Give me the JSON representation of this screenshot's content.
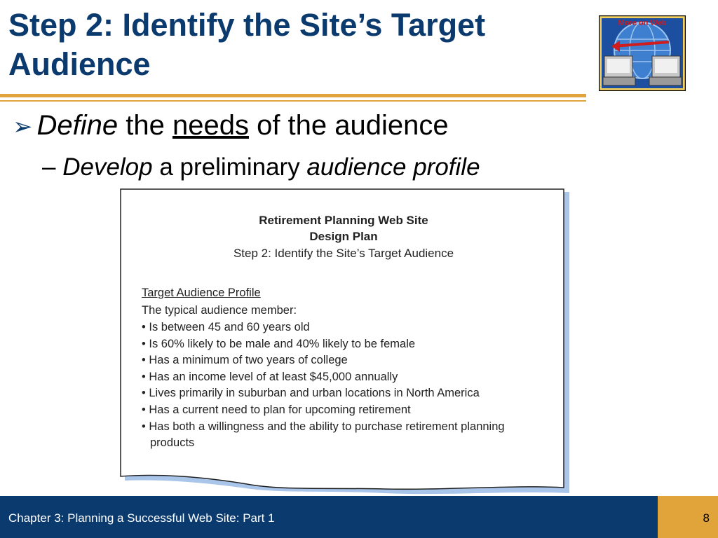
{
  "slide": {
    "title": "Step 2: Identify the Site’s Target Audience",
    "web_badge_label": "More on Web",
    "bullet1": {
      "italic": "Define",
      "pre": " the ",
      "underlined": "needs",
      "post": " of the audience"
    },
    "bullet2": {
      "dash": "–",
      "italic1": "Develop",
      "mid": " a preliminary ",
      "italic2": "audience profile"
    }
  },
  "document": {
    "heading1": "Retirement Planning Web Site",
    "heading2": "Design Plan",
    "heading3": "Step 2: Identify the Site’s Target Audience",
    "profile_label": "Target Audience Profile",
    "intro": "The typical audience member:",
    "items": [
      "• Is between 45 and 60 years old",
      "• Is 60% likely to be male and 40% likely to be female",
      "• Has a minimum of two years of college",
      "• Has an income level of at least $45,000 annually",
      "• Lives primarily in suburban and urban locations in North America",
      "• Has a current need to plan for upcoming retirement",
      "• Has both a willingness and the ability to purchase retirement planning"
    ],
    "last_item_continuation": "products"
  },
  "footer": {
    "chapter": "Chapter 3: Planning a Successful Web Site: Part 1",
    "page_number": "8"
  },
  "colors": {
    "title_blue": "#0b3a6e",
    "accent_gold": "#e0a43a",
    "paper_shadow": "#a9c6ea"
  }
}
